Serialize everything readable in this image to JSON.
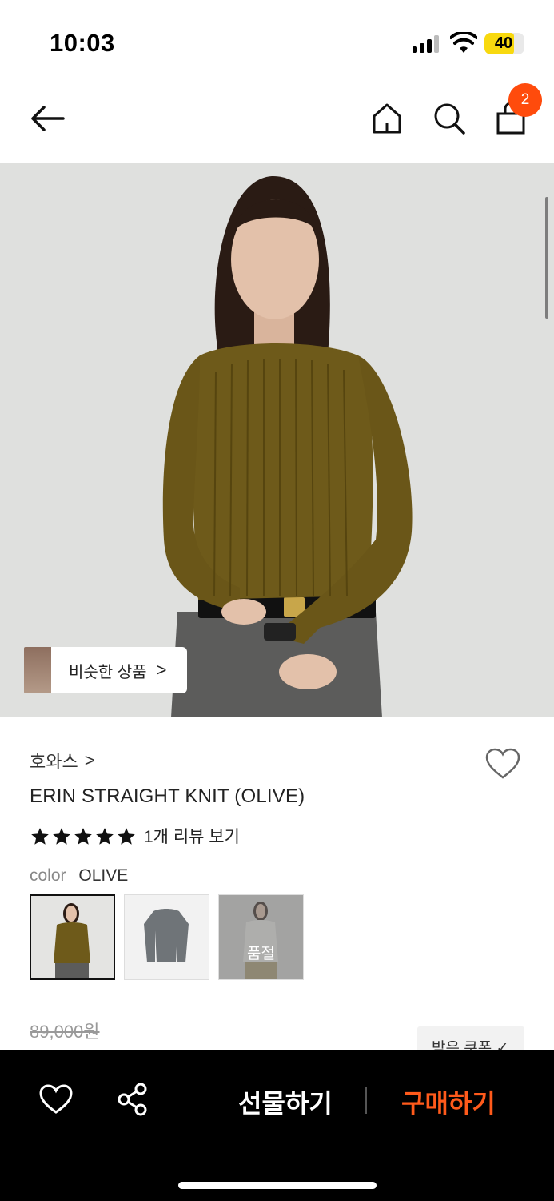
{
  "status_bar": {
    "time": "10:03",
    "battery": "40"
  },
  "nav": {
    "cart_count": "2",
    "icons": [
      "back-arrow-icon",
      "home-icon",
      "search-icon",
      "shopping-bag-icon"
    ]
  },
  "hero": {
    "similar_label": "비슷한 상품",
    "similar_chevron": ">"
  },
  "product": {
    "brand": "호와스",
    "brand_chevron": ">",
    "name": "ERIN STRAIGHT KNIT (OLIVE)",
    "rating": 5,
    "review_link": "1개 리뷰 보기",
    "color_label": "color",
    "color_value": "OLIVE",
    "swatches": [
      {
        "state": "selected"
      },
      {
        "state": "available"
      },
      {
        "state": "soldout",
        "label": "품절"
      }
    ],
    "original_price": "89,000원",
    "coupon_label": "받은 쿠폰 ✓"
  },
  "bottom_bar": {
    "gift_label": "선물하기",
    "buy_label": "구매하기"
  },
  "colors": {
    "accent": "#ff4b0c",
    "buy": "#ff5a1b",
    "knit_olive": "#6e5a1a"
  }
}
